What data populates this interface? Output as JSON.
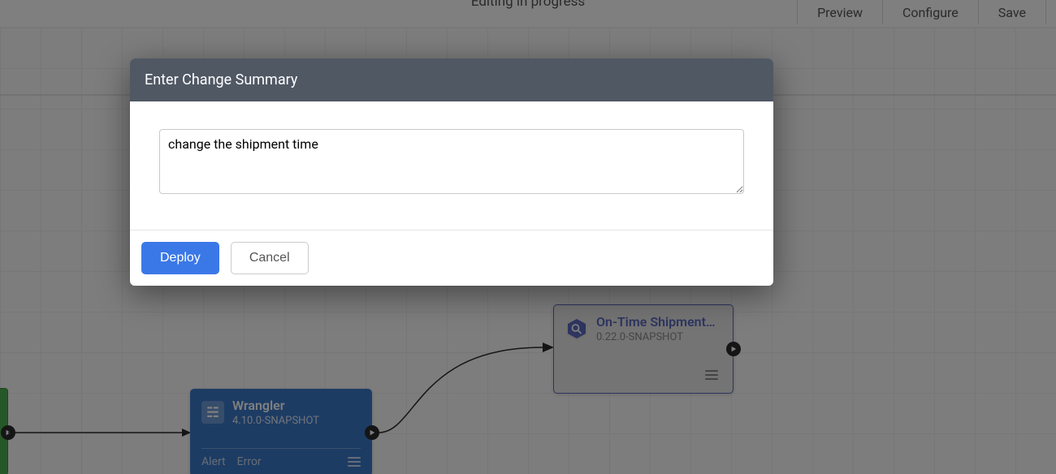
{
  "topbar": {
    "status": "Editing in progress",
    "buttons": {
      "preview": "Preview",
      "configure": "Configure",
      "save": "Save"
    }
  },
  "nodes": {
    "wrangler": {
      "title": "Wrangler",
      "version": "4.10.0-SNAPSHOT",
      "tabs": {
        "alert": "Alert",
        "error": "Error"
      }
    },
    "ontime": {
      "title": "On-Time Shipments …",
      "version": "0.22.0-SNAPSHOT"
    }
  },
  "modal": {
    "title": "Enter Change Summary",
    "value": "change the shipment time",
    "deploy": "Deploy",
    "cancel": "Cancel"
  },
  "colors": {
    "primary": "#3b78e7",
    "nodeBlue": "#3b78c9",
    "nodePurple": "#5c6bc0",
    "headerDark": "#505864"
  }
}
